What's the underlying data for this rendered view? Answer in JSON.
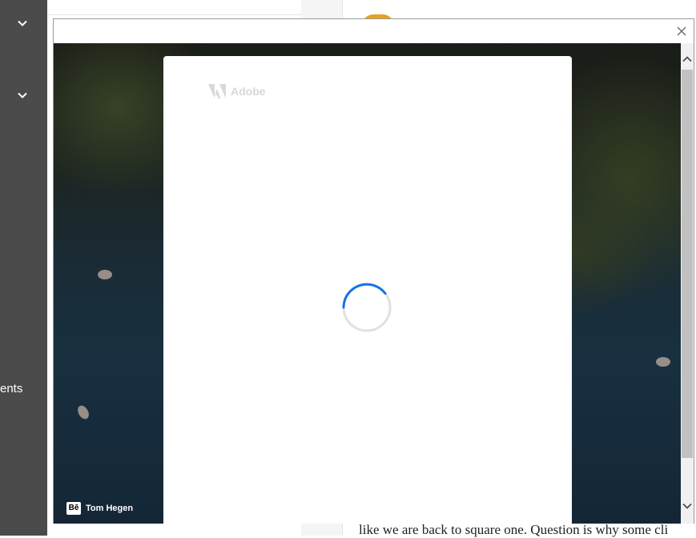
{
  "background_page": {
    "sidebar": {
      "partial_label": "ents"
    },
    "article": {
      "partial_text": "like we are back to square one. Question is why some cli"
    }
  },
  "dialog": {
    "photo_credit": {
      "badge": "Bē",
      "name": "Tom Hegen"
    },
    "login_card": {
      "brand": "Adobe",
      "status": "loading"
    }
  },
  "colors": {
    "sidebar_bg": "#4b4b4b",
    "spinner_accent": "#1473e6",
    "spinner_track": "#e1e1e1",
    "avatar": "#e8a21a"
  },
  "icons": [
    "chevron-down-icon",
    "close-icon",
    "adobe-logo-icon",
    "behance-icon",
    "chevron-up-icon"
  ]
}
